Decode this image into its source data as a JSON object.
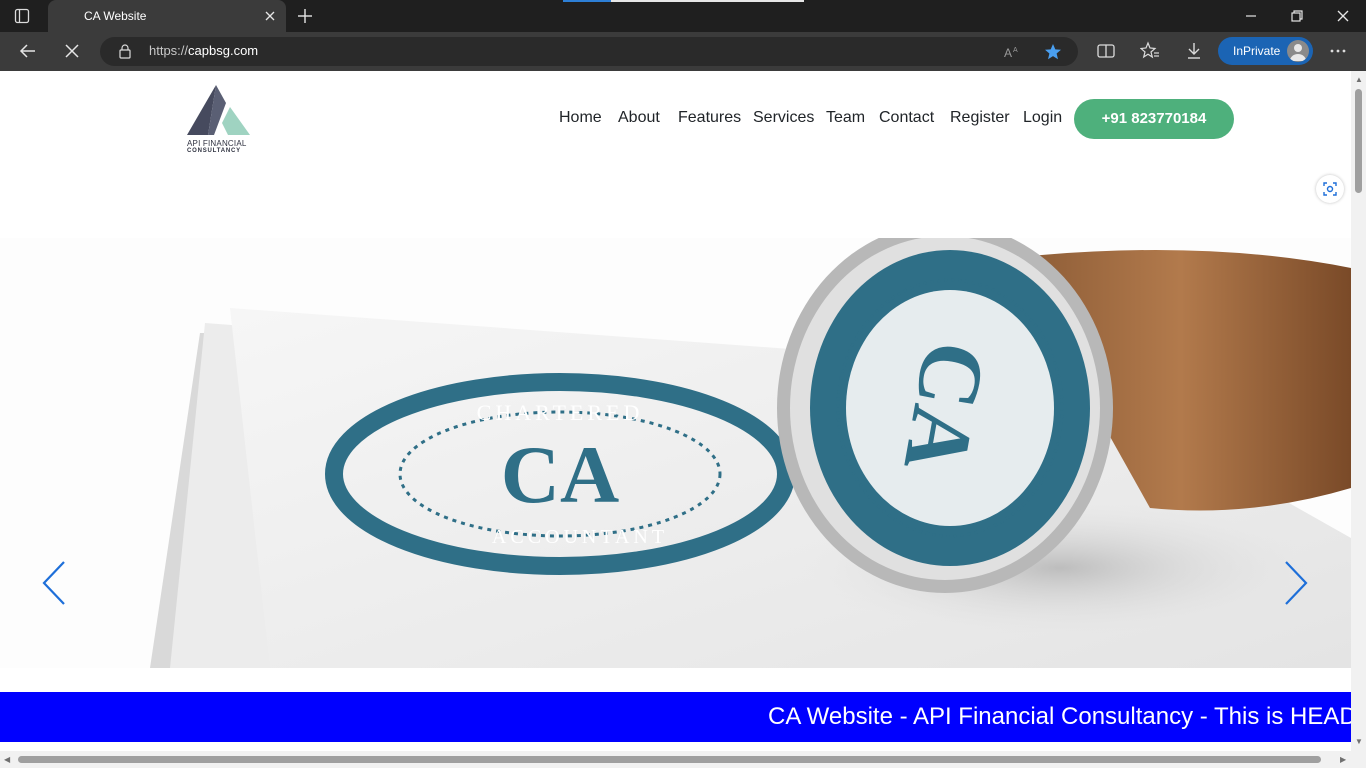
{
  "browser": {
    "tab_title": "CA Website",
    "url_scheme": "https://",
    "url_host": "capbsg.com",
    "inprivate_label": "InPrivate",
    "loading_progress": 0.2
  },
  "site": {
    "logo_text_line1": "API FINANCIAL",
    "logo_text_line2": "CONSULTANCY",
    "nav": [
      "Home",
      "About",
      "Features",
      "Services",
      "Team",
      "Contact",
      "Register",
      "Login"
    ],
    "phone": "+91 823770184",
    "hero_seal_top": "CHARTERED",
    "hero_seal_center": "CA",
    "hero_seal_bottom": "ACCOUNTANT",
    "marquee": "CA Website - API Financial Consultancy - This is HEAD"
  },
  "colors": {
    "accent_green": "#4eb07c",
    "marquee_blue": "#0000ff",
    "seal_teal": "#2f6f87",
    "inprivate_blue": "#1b64b4"
  },
  "icons": {
    "prev": "chevron-left-icon",
    "next": "chevron-right-icon",
    "favorite": "star-filled-icon",
    "reload": "stop-loading-icon"
  }
}
